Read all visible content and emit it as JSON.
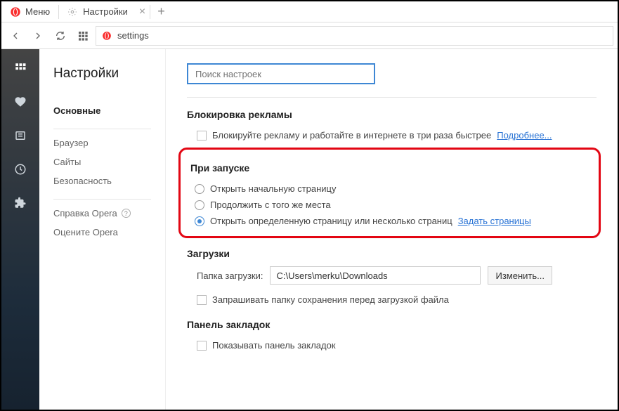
{
  "menu_label": "Меню",
  "tab": {
    "title": "Настройки"
  },
  "address": "settings",
  "page_title": "Настройки",
  "sidebar": {
    "items": [
      "Основные",
      "Браузер",
      "Сайты",
      "Безопасность"
    ],
    "help": "Справка Opera",
    "rate": "Оцените Opera"
  },
  "search_placeholder": "Поиск настроек",
  "adblock": {
    "title": "Блокировка рекламы",
    "checkbox": "Блокируйте рекламу и работайте в интернете в три раза быстрее",
    "more": "Подробнее..."
  },
  "startup": {
    "title": "При запуске",
    "options": [
      "Открыть начальную страницу",
      "Продолжить с того же места",
      "Открыть определенную страницу или несколько страниц"
    ],
    "set_pages": "Задать страницы",
    "selected_index": 2
  },
  "downloads": {
    "title": "Загрузки",
    "folder_label": "Папка загрузки:",
    "folder_value": "C:\\Users\\merku\\Downloads",
    "change": "Изменить...",
    "ask": "Запрашивать папку сохранения перед загрузкой файла"
  },
  "bookmarks": {
    "title": "Панель закладок",
    "show": "Показывать панель закладок"
  }
}
